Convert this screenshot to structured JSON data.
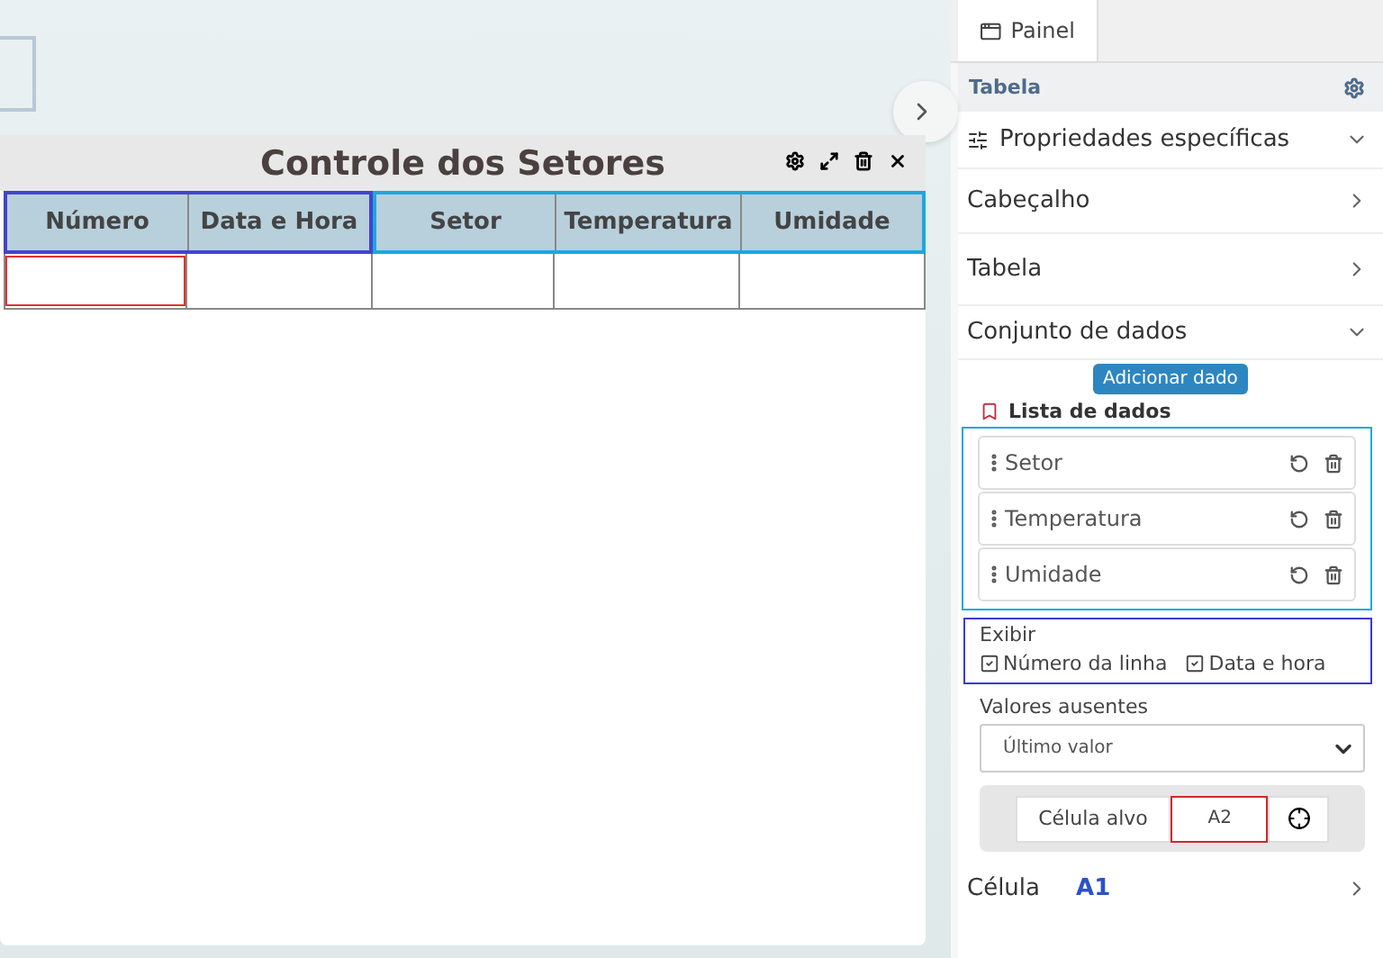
{
  "widget": {
    "title": "Controle dos Setores"
  },
  "table": {
    "columns": [
      {
        "label": "Número",
        "kind": "fixed"
      },
      {
        "label": "Data e Hora",
        "kind": "fixed"
      },
      {
        "label": "Setor",
        "kind": "data"
      },
      {
        "label": "Temperatura",
        "kind": "data"
      },
      {
        "label": "Umidade",
        "kind": "data"
      }
    ],
    "rows": [
      {
        "cells": [
          {
            "selected": true
          },
          {
            "selected": false
          },
          {
            "selected": false
          },
          {
            "selected": false
          },
          {
            "selected": false
          }
        ]
      }
    ]
  },
  "panel": {
    "tabs": [
      {
        "label": "Painel",
        "selected": true
      }
    ],
    "header": "Tabela",
    "sections": [
      {
        "label": "Propriedades específicas",
        "expanded": true,
        "kind": "props"
      },
      {
        "label": "Cabeçalho",
        "expanded": false,
        "kind": "plain"
      },
      {
        "label": "Tabela",
        "expanded": false,
        "kind": "plain"
      },
      {
        "label": "Conjunto de dados",
        "expanded": true,
        "kind": "plain"
      }
    ],
    "add_button": "Adicionar dado",
    "list_title": "Lista de dados",
    "data_items": [
      {
        "label": "Setor"
      },
      {
        "label": "Temperatura"
      },
      {
        "label": "Umidade"
      }
    ],
    "display": {
      "title": "Exibir",
      "options": [
        {
          "label": "Número da linha",
          "checked": true
        },
        {
          "label": "Data e hora",
          "checked": true
        }
      ]
    },
    "missing": {
      "label": "Valores ausentes",
      "value": "Último valor"
    },
    "target": {
      "label": "Célula alvo",
      "value": "A2"
    },
    "cell": {
      "label": "Célula",
      "value": "A1",
      "expanded": false
    }
  }
}
